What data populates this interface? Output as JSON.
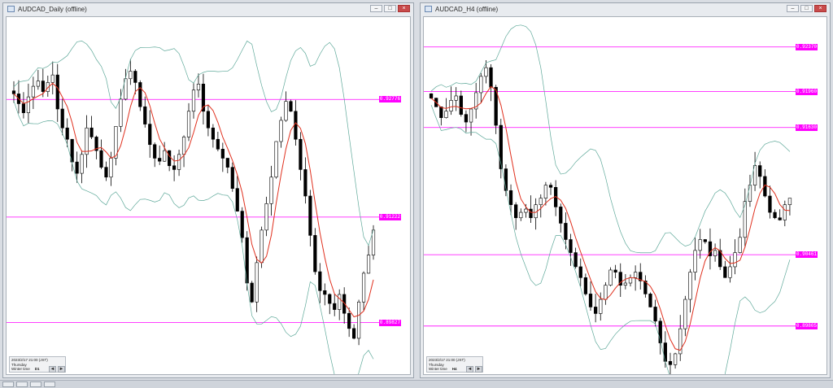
{
  "windows": [
    {
      "id": "daily",
      "title": "AUDCAD_Daily (offline)",
      "price_levels": [
        {
          "label": "0.92776",
          "y": 0.92776
        },
        {
          "label": "0.91222",
          "y": 0.91222
        },
        {
          "label": "0.89827",
          "y": 0.89827
        }
      ],
      "info": {
        "line1": "2023/2/17 21:00 (JST)",
        "line2": "Thursday",
        "line3": "Winter time",
        "timeframe": "D1"
      },
      "nav": {
        "prev": "◄",
        "next": "►"
      }
    },
    {
      "id": "h4",
      "title": "AUDCAD_H4 (offline)",
      "price_levels": [
        {
          "label": "0.92370",
          "y": 0.9237
        },
        {
          "label": "0.91960",
          "y": 0.9196
        },
        {
          "label": "0.91630",
          "y": 0.9163
        },
        {
          "label": "0.90461",
          "y": 0.90461
        },
        {
          "label": "0.89805",
          "y": 0.89805
        }
      ],
      "info": {
        "line1": "2023/2/17 21:00 (JST)",
        "line2": "Thursday",
        "line3": "Winter time",
        "timeframe": "H4"
      },
      "nav": {
        "prev": "◄",
        "next": "►"
      }
    }
  ],
  "window_buttons": {
    "minimize": "–",
    "maximize": "□",
    "close": "×"
  },
  "chart_data": [
    {
      "type": "candlestick",
      "title": "AUDCAD_Daily (offline)",
      "ylim": [
        0.892,
        0.938
      ],
      "horizontal_lines": [
        0.92776,
        0.91222,
        0.89827
      ],
      "series": [
        {
          "name": "close",
          "values": [
            0.9285,
            0.9272,
            0.926,
            0.9281,
            0.9295,
            0.9302,
            0.9288,
            0.93,
            0.931,
            0.9265,
            0.924,
            0.9225,
            0.9195,
            0.918,
            0.9205,
            0.924,
            0.9228,
            0.921,
            0.9188,
            0.9175,
            0.92,
            0.9242,
            0.9278,
            0.9305,
            0.9315,
            0.93,
            0.9268,
            0.9245,
            0.9218,
            0.92,
            0.9196,
            0.921,
            0.919,
            0.9185,
            0.9205,
            0.9228,
            0.9262,
            0.929,
            0.9298,
            0.9262,
            0.924,
            0.9225,
            0.9212,
            0.92,
            0.9188,
            0.916,
            0.913,
            0.9095,
            0.9035,
            0.901,
            0.9062,
            0.9105,
            0.914,
            0.9175,
            0.9222,
            0.925,
            0.9275,
            0.9262,
            0.9225,
            0.9185,
            0.915,
            0.9098,
            0.905,
            0.9025,
            0.902,
            0.9008,
            0.9,
            0.902,
            0.8995,
            0.8975,
            0.8962,
            0.901,
            0.9048,
            0.9072,
            0.9105
          ]
        }
      ]
    },
    {
      "type": "candlestick",
      "title": "AUDCAD_H4 (offline)",
      "ylim": [
        0.894,
        0.926
      ],
      "horizontal_lines": [
        0.9237,
        0.9196,
        0.9163,
        0.90461,
        0.89805
      ],
      "series": [
        {
          "name": "close",
          "values": [
            0.919,
            0.9182,
            0.9172,
            0.9178,
            0.9188,
            0.9192,
            0.9175,
            0.9168,
            0.918,
            0.9195,
            0.921,
            0.9218,
            0.92,
            0.9165,
            0.9125,
            0.9105,
            0.9092,
            0.908,
            0.9085,
            0.9088,
            0.908,
            0.9092,
            0.9098,
            0.911,
            0.9108,
            0.909,
            0.9075,
            0.906,
            0.9048,
            0.9035,
            0.9025,
            0.901,
            0.8998,
            0.8992,
            0.9005,
            0.9018,
            0.9032,
            0.903,
            0.9018,
            0.902,
            0.9025,
            0.903,
            0.9022,
            0.901,
            0.8998,
            0.8985,
            0.8965,
            0.8948,
            0.8945,
            0.8955,
            0.8978,
            0.9005,
            0.903,
            0.905,
            0.906,
            0.9058,
            0.9045,
            0.905,
            0.9035,
            0.9025,
            0.9035,
            0.9048,
            0.9062,
            0.9095,
            0.911,
            0.9128,
            0.9118,
            0.91,
            0.9085,
            0.908,
            0.9078,
            0.9092,
            0.9098
          ]
        }
      ]
    }
  ]
}
